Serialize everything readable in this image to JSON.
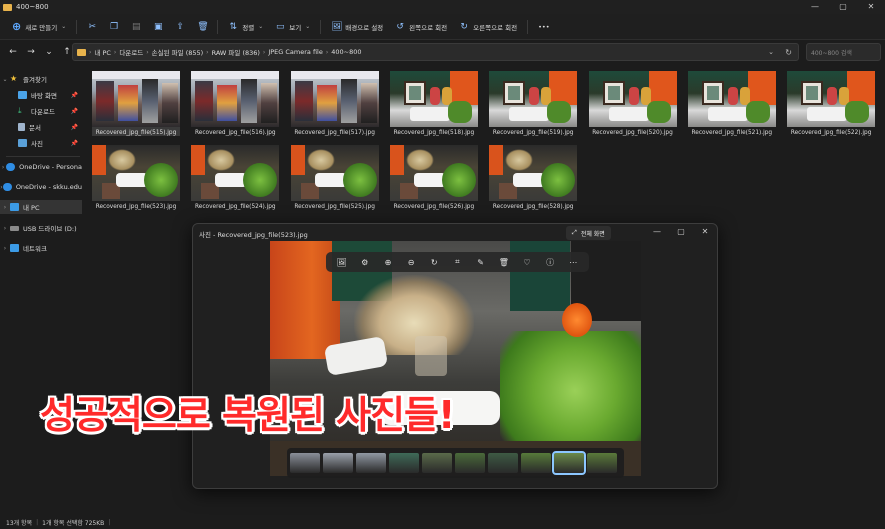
{
  "window": {
    "title": "400~800",
    "min": "—",
    "max": "▢",
    "close": "✕"
  },
  "toolbar": {
    "new_label": "새로 만들기",
    "sort_label": "정렬",
    "view_label": "보기",
    "set_bg_label": "배경으로 설정",
    "rotate_left_label": "왼쪽으로 회전",
    "rotate_right_label": "오른쪽으로 회전",
    "more_label": "•••"
  },
  "address": {
    "crumbs": [
      "내 PC",
      "다운로드",
      "손실된 파일 (855)",
      "RAW 파일 (836)",
      "JPEG Camera file",
      "400~800"
    ],
    "search_placeholder": "400~800 검색"
  },
  "sidebar": {
    "items": [
      {
        "label": "즐겨찾기"
      },
      {
        "label": "바탕 화면"
      },
      {
        "label": "다운로드"
      },
      {
        "label": "문서"
      },
      {
        "label": "사진"
      },
      {
        "label": "OneDrive - Persona"
      },
      {
        "label": "OneDrive - skku.edu"
      },
      {
        "label": "내 PC"
      },
      {
        "label": "USB 드라이브 (D:)"
      },
      {
        "label": "네트워크"
      }
    ]
  },
  "files": [
    {
      "name": "Recovered_jpg_file(515).jpg",
      "scene": "store"
    },
    {
      "name": "Recovered_jpg_file(516).jpg",
      "scene": "store"
    },
    {
      "name": "Recovered_jpg_file(517).jpg",
      "scene": "store"
    },
    {
      "name": "Recovered_jpg_file(518).jpg",
      "scene": "shelf"
    },
    {
      "name": "Recovered_jpg_file(519).jpg",
      "scene": "shelf"
    },
    {
      "name": "Recovered_jpg_file(520).jpg",
      "scene": "shelf"
    },
    {
      "name": "Recovered_jpg_file(521).jpg",
      "scene": "shelf"
    },
    {
      "name": "Recovered_jpg_file(522).jpg",
      "scene": "shelf"
    },
    {
      "name": "Recovered_jpg_file(523).jpg",
      "scene": "plants"
    },
    {
      "name": "Recovered_jpg_file(524).jpg",
      "scene": "plants"
    },
    {
      "name": "Recovered_jpg_file(525).jpg",
      "scene": "plants"
    },
    {
      "name": "Recovered_jpg_file(526).jpg",
      "scene": "plants"
    },
    {
      "name": "Recovered_jpg_file(528).jpg",
      "scene": "plants"
    }
  ],
  "viewer": {
    "title": "사진 - Recovered_jpg_file(523).jpg",
    "fullscreen_label": "전체 화면",
    "filmstrip_count": 10,
    "active_film_index": 8
  },
  "caption": "성공적으로 복원된 사진들!",
  "status": {
    "items_count": "13개 항목",
    "selected": "1개 항목 선택함 725KB"
  },
  "colors": {
    "accent": "#8cc7ff",
    "caption": "#ff2a2a"
  }
}
